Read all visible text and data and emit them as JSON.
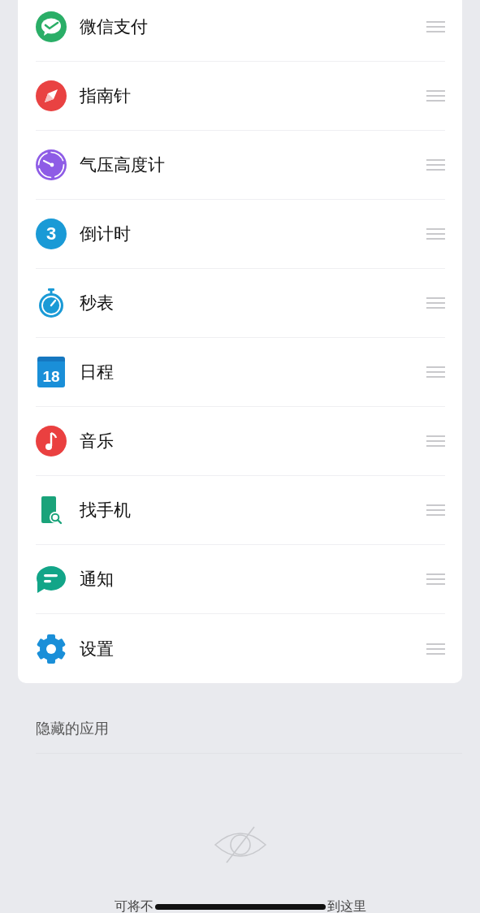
{
  "apps": [
    {
      "kind": "wechat-pay",
      "label": "微信支付"
    },
    {
      "kind": "compass",
      "label": "指南针"
    },
    {
      "kind": "barometer",
      "label": "气压高度计"
    },
    {
      "kind": "countdown",
      "label": "倒计时",
      "icon_text": "3"
    },
    {
      "kind": "stopwatch",
      "label": "秒表"
    },
    {
      "kind": "calendar",
      "label": "日程",
      "icon_text": "18"
    },
    {
      "kind": "music",
      "label": "音乐"
    },
    {
      "kind": "find-phone",
      "label": "找手机"
    },
    {
      "kind": "notification",
      "label": "通知"
    },
    {
      "kind": "settings",
      "label": "设置"
    }
  ],
  "hidden_section": {
    "title": "隐藏的应用",
    "hint_parts": [
      "可将不",
      "到这里"
    ]
  }
}
